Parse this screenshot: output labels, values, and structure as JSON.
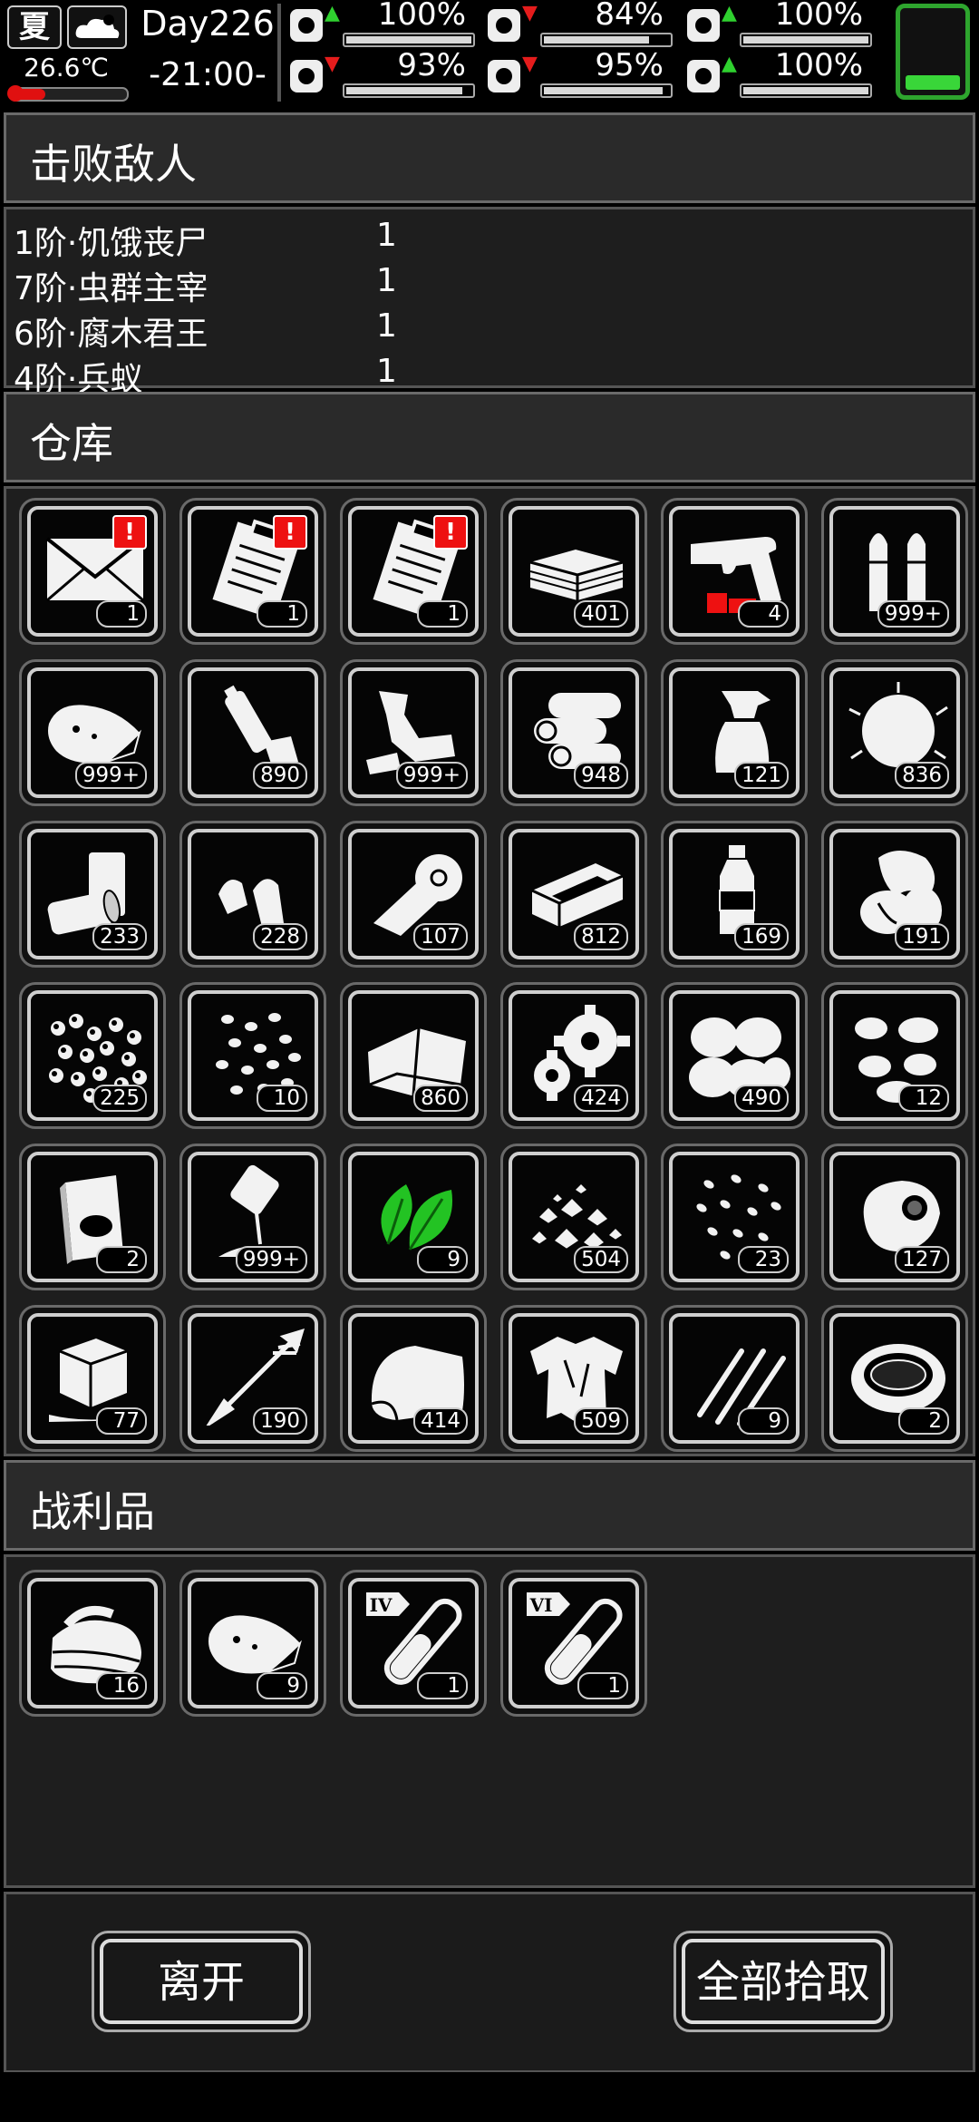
{
  "status": {
    "season": "夏",
    "temperature": "26.6℃",
    "day": "Day226",
    "time": "-21:00-",
    "stats": [
      {
        "name": "health",
        "icon": "medkit-icon",
        "arrow": "up",
        "value": "100%",
        "level": 1.0
      },
      {
        "name": "hunger",
        "icon": "stomach-icon",
        "arrow": "down",
        "value": "84%",
        "level": 0.84
      },
      {
        "name": "mood",
        "icon": "jar-icon",
        "arrow": "up",
        "value": "100%",
        "level": 1.0
      },
      {
        "name": "stamina",
        "icon": "leg-icon",
        "arrow": "down",
        "value": "93%",
        "level": 0.93
      },
      {
        "name": "thirst",
        "icon": "water-drop-icon",
        "arrow": "down",
        "value": "95%",
        "level": 0.95
      },
      {
        "name": "spirit",
        "icon": "heart-icon",
        "arrow": "up",
        "value": "100%",
        "level": 1.0
      }
    ]
  },
  "defeated": {
    "title": "击败敌人",
    "enemies": [
      {
        "name": "1阶·饥饿丧尸",
        "count": "1"
      },
      {
        "name": "7阶·虫群主宰",
        "count": "1"
      },
      {
        "name": "6阶·腐木君王",
        "count": "1"
      },
      {
        "name": "4阶·兵蚁",
        "count": "1"
      }
    ]
  },
  "storage": {
    "title": "仓库",
    "items": [
      {
        "icon": "envelope-icon",
        "count": "1",
        "alert": "!"
      },
      {
        "icon": "clipboard-icon",
        "count": "1",
        "alert": "!"
      },
      {
        "icon": "clipboard-icon",
        "count": "1",
        "alert": "!"
      },
      {
        "icon": "cash-stack-icon",
        "count": "401"
      },
      {
        "icon": "flare-gun-icon",
        "count": "4"
      },
      {
        "icon": "bullets-icon",
        "count": "999+"
      },
      {
        "icon": "meat-icon",
        "count": "999+"
      },
      {
        "icon": "bottles-icon",
        "count": "890"
      },
      {
        "icon": "scrap-metal-icon",
        "count": "999+"
      },
      {
        "icon": "logs-icon",
        "count": "948"
      },
      {
        "icon": "spray-bottle-icon",
        "count": "121"
      },
      {
        "icon": "cotton-icon",
        "count": "836"
      },
      {
        "icon": "cans-icon",
        "count": "233"
      },
      {
        "icon": "bullet-tips-icon",
        "count": "228"
      },
      {
        "icon": "bandage-roll-icon",
        "count": "107"
      },
      {
        "icon": "board-icon",
        "count": "812"
      },
      {
        "icon": "water-bottle-icon",
        "count": "169"
      },
      {
        "icon": "vegetable-icon",
        "count": "191"
      },
      {
        "icon": "beads-icon",
        "count": "225"
      },
      {
        "icon": "seeds-icon",
        "count": "10"
      },
      {
        "icon": "cloth-sheet-icon",
        "count": "860"
      },
      {
        "icon": "gears-icon",
        "count": "424"
      },
      {
        "icon": "potatoes-icon",
        "count": "490"
      },
      {
        "icon": "peanuts-icon",
        "count": "12"
      },
      {
        "icon": "book-icon",
        "count": "2"
      },
      {
        "icon": "powder-pour-icon",
        "count": "999+"
      },
      {
        "icon": "herb-leaves-icon",
        "count": "9",
        "color": "#23c323"
      },
      {
        "icon": "rubble-icon",
        "count": "504"
      },
      {
        "icon": "grain-icon",
        "count": "23"
      },
      {
        "icon": "egg-icon",
        "count": "127"
      },
      {
        "icon": "ice-cube-icon",
        "count": "77"
      },
      {
        "icon": "arrow-icon",
        "count": "190"
      },
      {
        "icon": "towel-icon",
        "count": "414"
      },
      {
        "icon": "torn-shirt-icon",
        "count": "509"
      },
      {
        "icon": "claw-marks-icon",
        "count": "9"
      },
      {
        "icon": "soup-bowl-icon",
        "count": "2"
      }
    ]
  },
  "loot": {
    "title": "战利品",
    "items": [
      {
        "icon": "cloth-pile-icon",
        "count": "16"
      },
      {
        "icon": "meat-icon",
        "count": "9"
      },
      {
        "icon": "test-tube-icon",
        "count": "1",
        "tag": "IV"
      },
      {
        "icon": "test-tube-icon",
        "count": "1",
        "tag": "VI"
      }
    ]
  },
  "actions": {
    "leave": "离开",
    "take_all": "全部拾取"
  },
  "colors": {
    "up_arrow": "#2fd12f",
    "down_arrow": "#e51c1c",
    "battery": "#2ea52e"
  }
}
